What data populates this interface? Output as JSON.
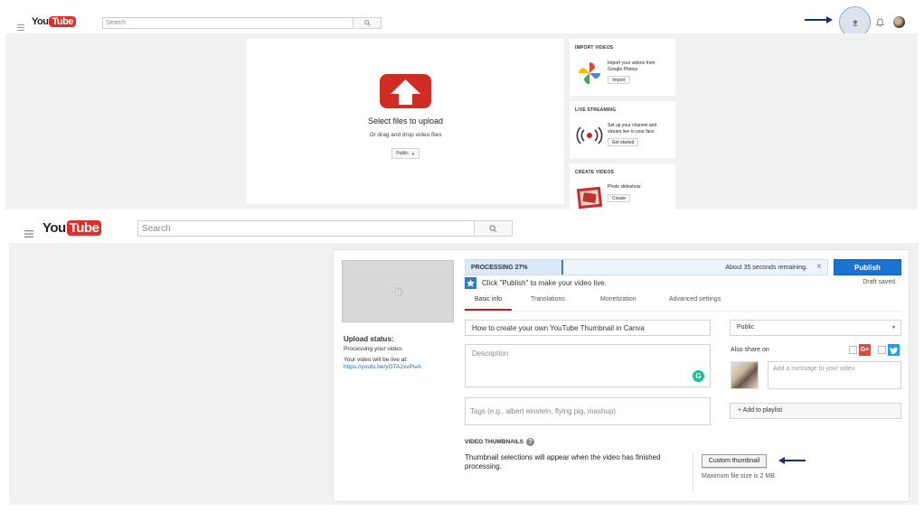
{
  "top": {
    "logo": {
      "you": "You",
      "tube": "Tube"
    },
    "search_placeholder": "Search",
    "upload": {
      "title": "Select files to upload",
      "subtitle": "Or drag and drop video files",
      "privacy": "Public"
    },
    "import": {
      "title": "IMPORT VIDEOS",
      "text_1": "Import your videos from",
      "text_2": "Google Photos",
      "button": "Import"
    },
    "live": {
      "title": "LIVE STREAMING",
      "text_1": "Set up your channel and",
      "text_2": "stream live to your fans",
      "button": "Get started"
    },
    "create": {
      "title": "CREATE VIDEOS",
      "text_1": "Photo slideshow",
      "button": "Create"
    }
  },
  "bottom": {
    "logo": {
      "you": "You",
      "tube": "Tube"
    },
    "search_placeholder": "Search",
    "upload_status": {
      "heading": "Upload status:",
      "line1": "Processing your video.",
      "line2": "Your video will be live at:",
      "link": "https://youtu.be/yOTA2xvPivA"
    },
    "progress": {
      "label": "PROCESSING 27%",
      "percent": 27,
      "remaining": "About 35 seconds remaining.",
      "close": "×"
    },
    "publish_button": "Publish",
    "draft_status": "Draft saved.",
    "hint": "Click \"Publish\" to make your video live.",
    "tabs": [
      "Basic info",
      "Translations",
      "Monetization",
      "Advanced settings"
    ],
    "title_value": "How to create your own YouTube Thumbnail in Canva",
    "description_placeholder": "Description",
    "tags_placeholder": "Tags (e.g., albert einstein, flying pig, mashup)",
    "privacy": "Public",
    "also_share": "Also share on",
    "message_placeholder": "Add a message to your video",
    "add_playlist": "+ Add to playlist",
    "thumbnails": {
      "heading": "VIDEO THUMBNAILS",
      "text_1": "Thumbnail selections will appear when the video has finished",
      "text_2": "processing.",
      "button": "Custom thumbnail",
      "max_size": "Maximum file size is 2 MB."
    }
  },
  "colors": {
    "youtube_red": "#e52d27",
    "publish_blue": "#1a73d1",
    "arrow_navy": "#1b2f6e",
    "progress_blue": "#d9e9f7"
  }
}
